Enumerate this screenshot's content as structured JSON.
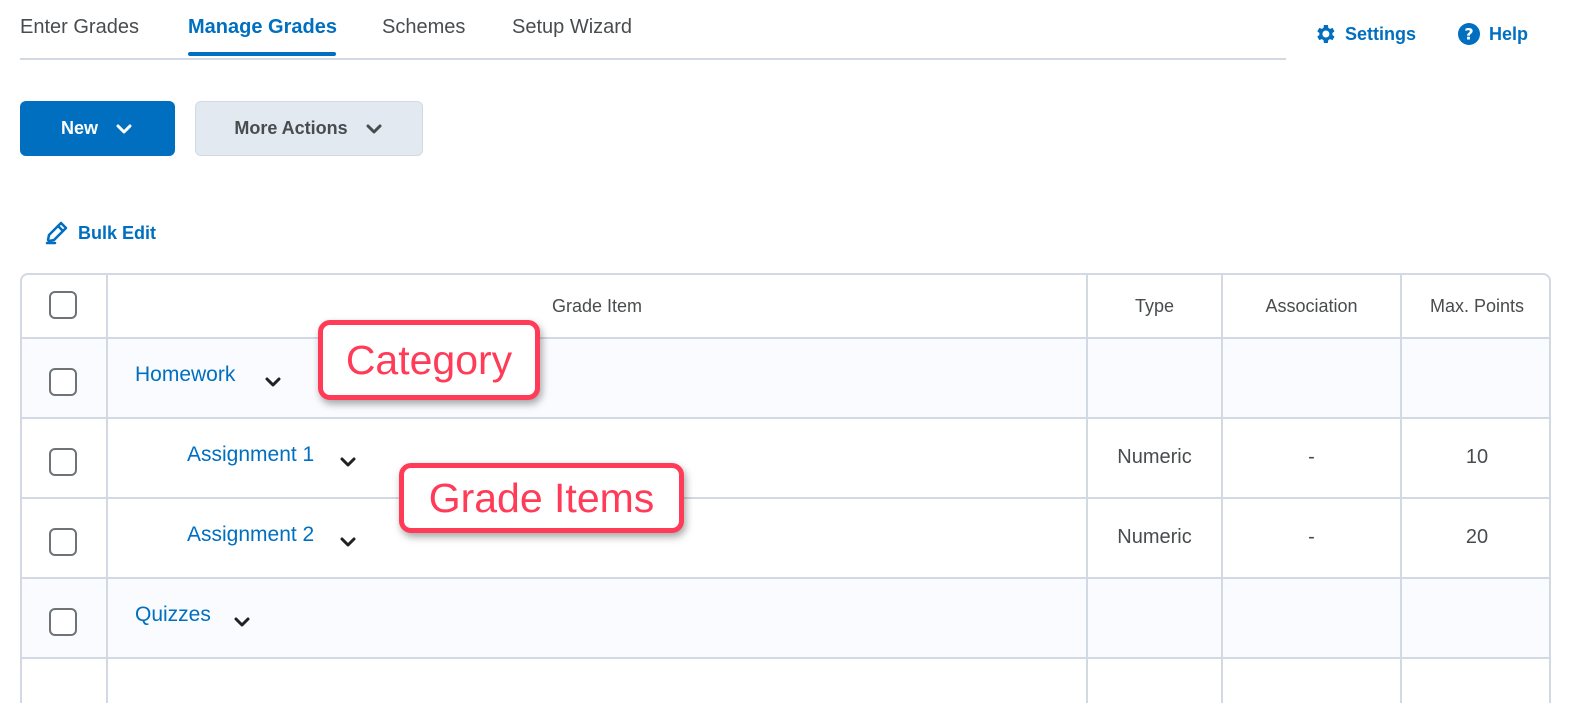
{
  "tabs": [
    "Enter Grades",
    "Manage Grades",
    "Schemes",
    "Setup Wizard"
  ],
  "active_tab": "Manage Grades",
  "top_links": {
    "settings": "Settings",
    "help": "Help"
  },
  "actions": {
    "new_label": "New",
    "more_actions_label": "More Actions"
  },
  "bulk_edit_label": "Bulk Edit",
  "table": {
    "headers": {
      "grade_item": "Grade Item",
      "type": "Type",
      "association": "Association",
      "max_points": "Max. Points"
    },
    "rows": [
      {
        "name": "Homework",
        "kind": "category",
        "type": "",
        "association": "",
        "max_points": ""
      },
      {
        "name": "Assignment 1",
        "kind": "item",
        "type": "Numeric",
        "association": "-",
        "max_points": "10"
      },
      {
        "name": "Assignment 2",
        "kind": "item",
        "type": "Numeric",
        "association": "-",
        "max_points": "20"
      },
      {
        "name": "Quizzes",
        "kind": "category",
        "type": "",
        "association": "",
        "max_points": ""
      }
    ]
  },
  "callouts": {
    "category": "Category",
    "grade_items": "Grade Items"
  },
  "colors": {
    "accent": "#006fbf",
    "callout": "#ff3b58",
    "border": "#d3d9e3"
  },
  "icons": {
    "settings": "gear-icon",
    "help": "question-circle-icon",
    "bulk_edit": "pencil-icon",
    "expand": "chevron-down-icon"
  }
}
